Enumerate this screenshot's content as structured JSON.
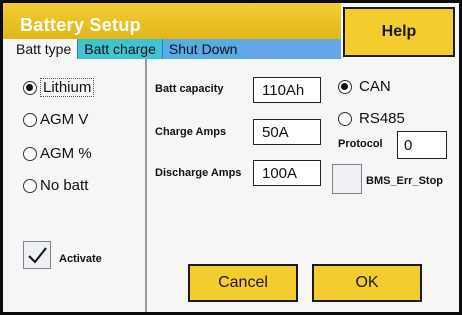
{
  "window": {
    "title": "Battery Setup"
  },
  "help_label": "Help",
  "tabs": [
    {
      "label": "Batt type",
      "active": true
    },
    {
      "label": "Batt charge",
      "active": false
    },
    {
      "label": "Shut Down",
      "active": false
    }
  ],
  "battery_types": [
    {
      "label": "Lithium",
      "selected": true
    },
    {
      "label": "AGM V",
      "selected": false
    },
    {
      "label": "AGM %",
      "selected": false
    },
    {
      "label": "No batt",
      "selected": false
    }
  ],
  "activate": {
    "label": "Activate",
    "checked": true
  },
  "fields": [
    {
      "label": "Batt capacity",
      "value": "110Ah"
    },
    {
      "label": "Charge Amps",
      "value": "50A"
    },
    {
      "label": "Discharge Amps",
      "value": "100A"
    }
  ],
  "comm": [
    {
      "label": "CAN",
      "selected": true
    },
    {
      "label": "RS485",
      "selected": false
    }
  ],
  "protocol": {
    "label": "Protocol",
    "value": "0"
  },
  "bms_err_stop": {
    "label": "BMS_Err_Stop",
    "checked": false
  },
  "buttons": {
    "cancel": "Cancel",
    "ok": "OK"
  },
  "colors": {
    "accent_yellow": "#f3cd2e",
    "tab_blue": "#63a7e6",
    "tab_cyan": "#3fc4d6"
  }
}
